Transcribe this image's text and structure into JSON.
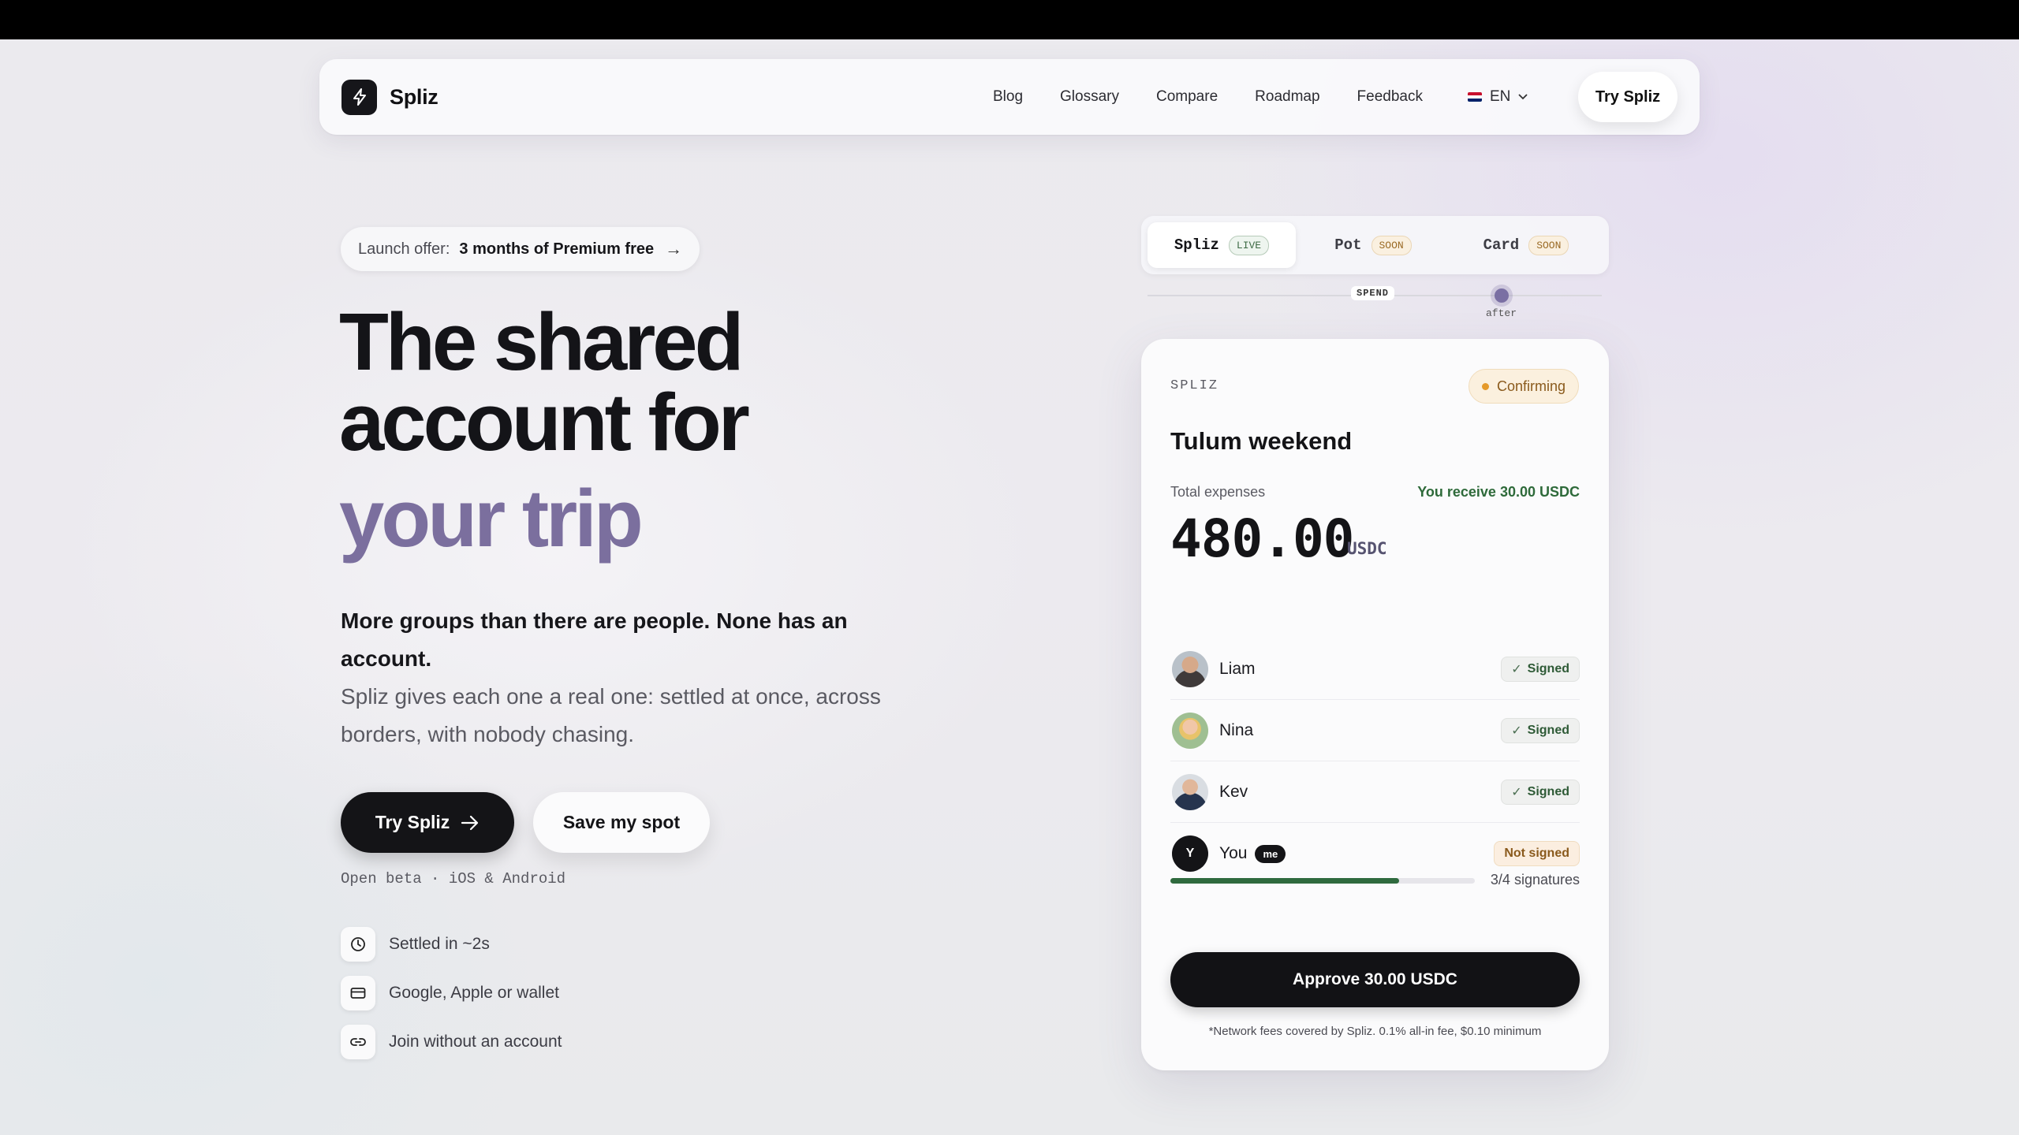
{
  "header": {
    "brand": "Spliz",
    "nav": [
      "Blog",
      "Glossary",
      "Compare",
      "Roadmap",
      "Feedback"
    ],
    "language": "EN",
    "cta": "Try Spliz",
    "icons": {
      "logo": "bolt-icon",
      "language_flag": "uk-flag-icon",
      "language_chevron": "chevron-down-icon"
    }
  },
  "hero": {
    "offer_label": "Launch offer:",
    "offer_value": "3 months of Premium free",
    "offer_arrow": "→",
    "title_line1": "The shared",
    "title_line2": "account for",
    "title_line3": "your trip",
    "lead": "More groups than there are people. None has an account.",
    "sub": "Spliz gives each one a real one: settled at once, across borders, with nobody chasing.",
    "primary_cta": "Try Spliz",
    "secondary_cta": "Save my spot",
    "beta_note": "Open beta · iOS & Android",
    "features": [
      {
        "icon": "clock-icon",
        "label": "Settled in ~2s"
      },
      {
        "icon": "card-icon",
        "label": "Google, Apple or wallet"
      },
      {
        "icon": "link-icon",
        "label": "Join without an account"
      }
    ]
  },
  "demo": {
    "tabs": [
      {
        "label": "Spliz",
        "badge": "LIVE",
        "active": true
      },
      {
        "label": "Pot",
        "badge": "SOON",
        "active": false
      },
      {
        "label": "Card",
        "badge": "SOON",
        "active": false
      }
    ],
    "timeline_label": "SPEND",
    "timeline_marker": "after",
    "card": {
      "label": "SPLIZ",
      "status": "Confirming",
      "title": "Tulum weekend",
      "total_label": "Total expenses",
      "receive": "You receive 30.00 USDC",
      "amount": "480.00",
      "unit": "USDC",
      "members": [
        {
          "name": "Liam",
          "status": "Signed",
          "avatar": "avatar-liam"
        },
        {
          "name": "Nina",
          "status": "Signed",
          "avatar": "avatar-nina"
        },
        {
          "name": "Kev",
          "status": "Signed",
          "avatar": "avatar-kev"
        },
        {
          "name": "You",
          "status": "Not signed",
          "avatar": "Y",
          "tag": "me"
        }
      ],
      "signatures": "3/4 signatures",
      "progress": 0.75,
      "approve": "Approve 30.00 USDC",
      "fee_note": "*Network fees covered by Spliz. 0.1% all-in fee, $0.10 minimum"
    }
  },
  "colors": {
    "accent_purple": "#7b6f9e",
    "dark": "#141417",
    "success_green": "#2e6a3a",
    "warning_orange": "#e59a2a"
  }
}
